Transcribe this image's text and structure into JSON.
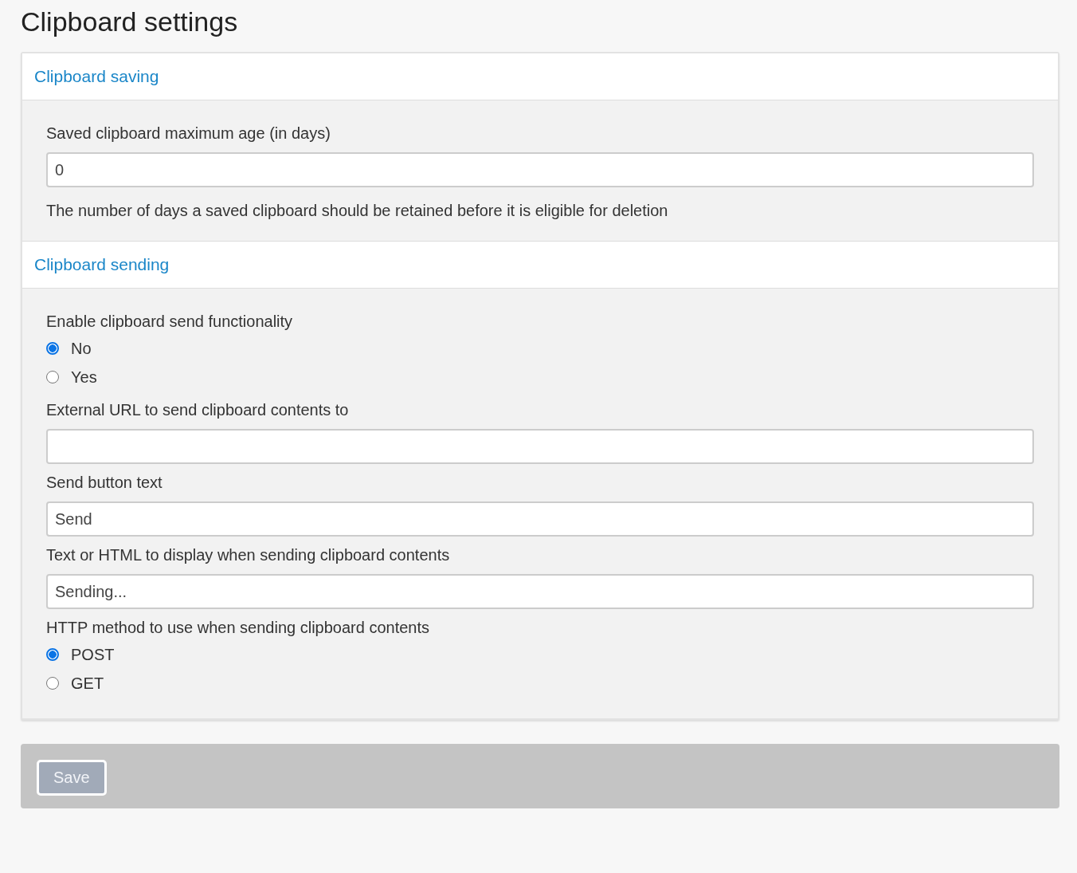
{
  "page_title": "Clipboard settings",
  "sections": [
    {
      "title": "Clipboard saving",
      "fields": [
        {
          "kind": "text",
          "label": "Saved clipboard maximum age (in days)",
          "value": "0",
          "help": "The number of days a saved clipboard should be retained before it is eligible for deletion"
        }
      ]
    },
    {
      "title": "Clipboard sending",
      "fields": [
        {
          "kind": "radio",
          "label": "Enable clipboard send functionality",
          "options": [
            {
              "label": "No",
              "selected": true
            },
            {
              "label": "Yes",
              "selected": false
            }
          ]
        },
        {
          "kind": "text",
          "label": "External URL to send clipboard contents to"
        },
        {
          "kind": "text",
          "label": "Send button text",
          "value": "Send"
        },
        {
          "kind": "text",
          "label": "Text or HTML to display when sending clipboard contents",
          "value": "Sending..."
        },
        {
          "kind": "radio",
          "label": "HTTP method to use when sending clipboard contents",
          "options": [
            {
              "label": "POST",
              "selected": true
            },
            {
              "label": "GET",
              "selected": false
            }
          ]
        }
      ]
    }
  ],
  "save_button": {
    "label": "Save",
    "disabled": true
  }
}
